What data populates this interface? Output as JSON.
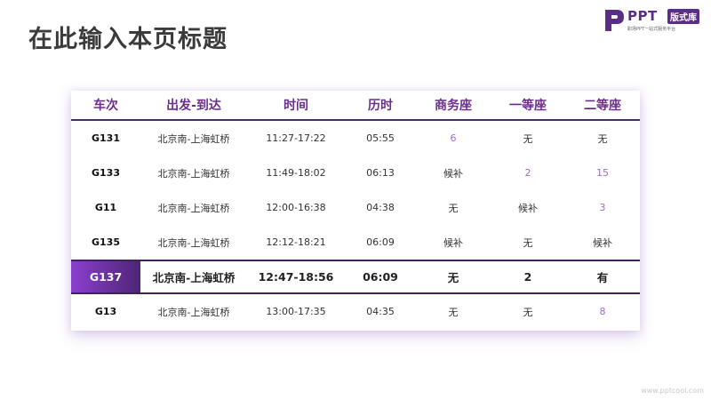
{
  "page": {
    "title": "在此输入本页标题",
    "watermark": "www.pptcool.com"
  },
  "logo": {
    "word": "PPT",
    "badge": "版式库",
    "tagline": "职场PPT一站式服务平台"
  },
  "table": {
    "columns": [
      "车次",
      "出发-到达",
      "时间",
      "历时",
      "商务座",
      "一等座",
      "二等座"
    ],
    "rows": [
      [
        "G131",
        "北京南-上海虹桥",
        "11:27-17:22",
        "05:55",
        "6",
        "无",
        "无"
      ],
      [
        "G133",
        "北京南-上海虹桥",
        "11:49-18:02",
        "06:13",
        "候补",
        "2",
        "15"
      ],
      [
        "G11",
        "北京南-上海虹桥",
        "12:00-16:38",
        "04:38",
        "无",
        "候补",
        "3"
      ],
      [
        "G135",
        "北京南-上海虹桥",
        "12:12-18:21",
        "06:09",
        "候补",
        "无",
        "候补"
      ],
      [
        "G137",
        "北京南-上海虹桥",
        "12:47-18:56",
        "06:09",
        "无",
        "2",
        "有"
      ],
      [
        "G13",
        "北京南-上海虹桥",
        "13:00-17:35",
        "04:35",
        "无",
        "无",
        "8"
      ]
    ],
    "highlighted_row": 4
  },
  "colors": {
    "accent": "#6b2e8e",
    "highlight_gradient_start": "#8a3fcf",
    "highlight_gradient_end": "#4e2575",
    "numeric_seat": "#a06ad0"
  }
}
